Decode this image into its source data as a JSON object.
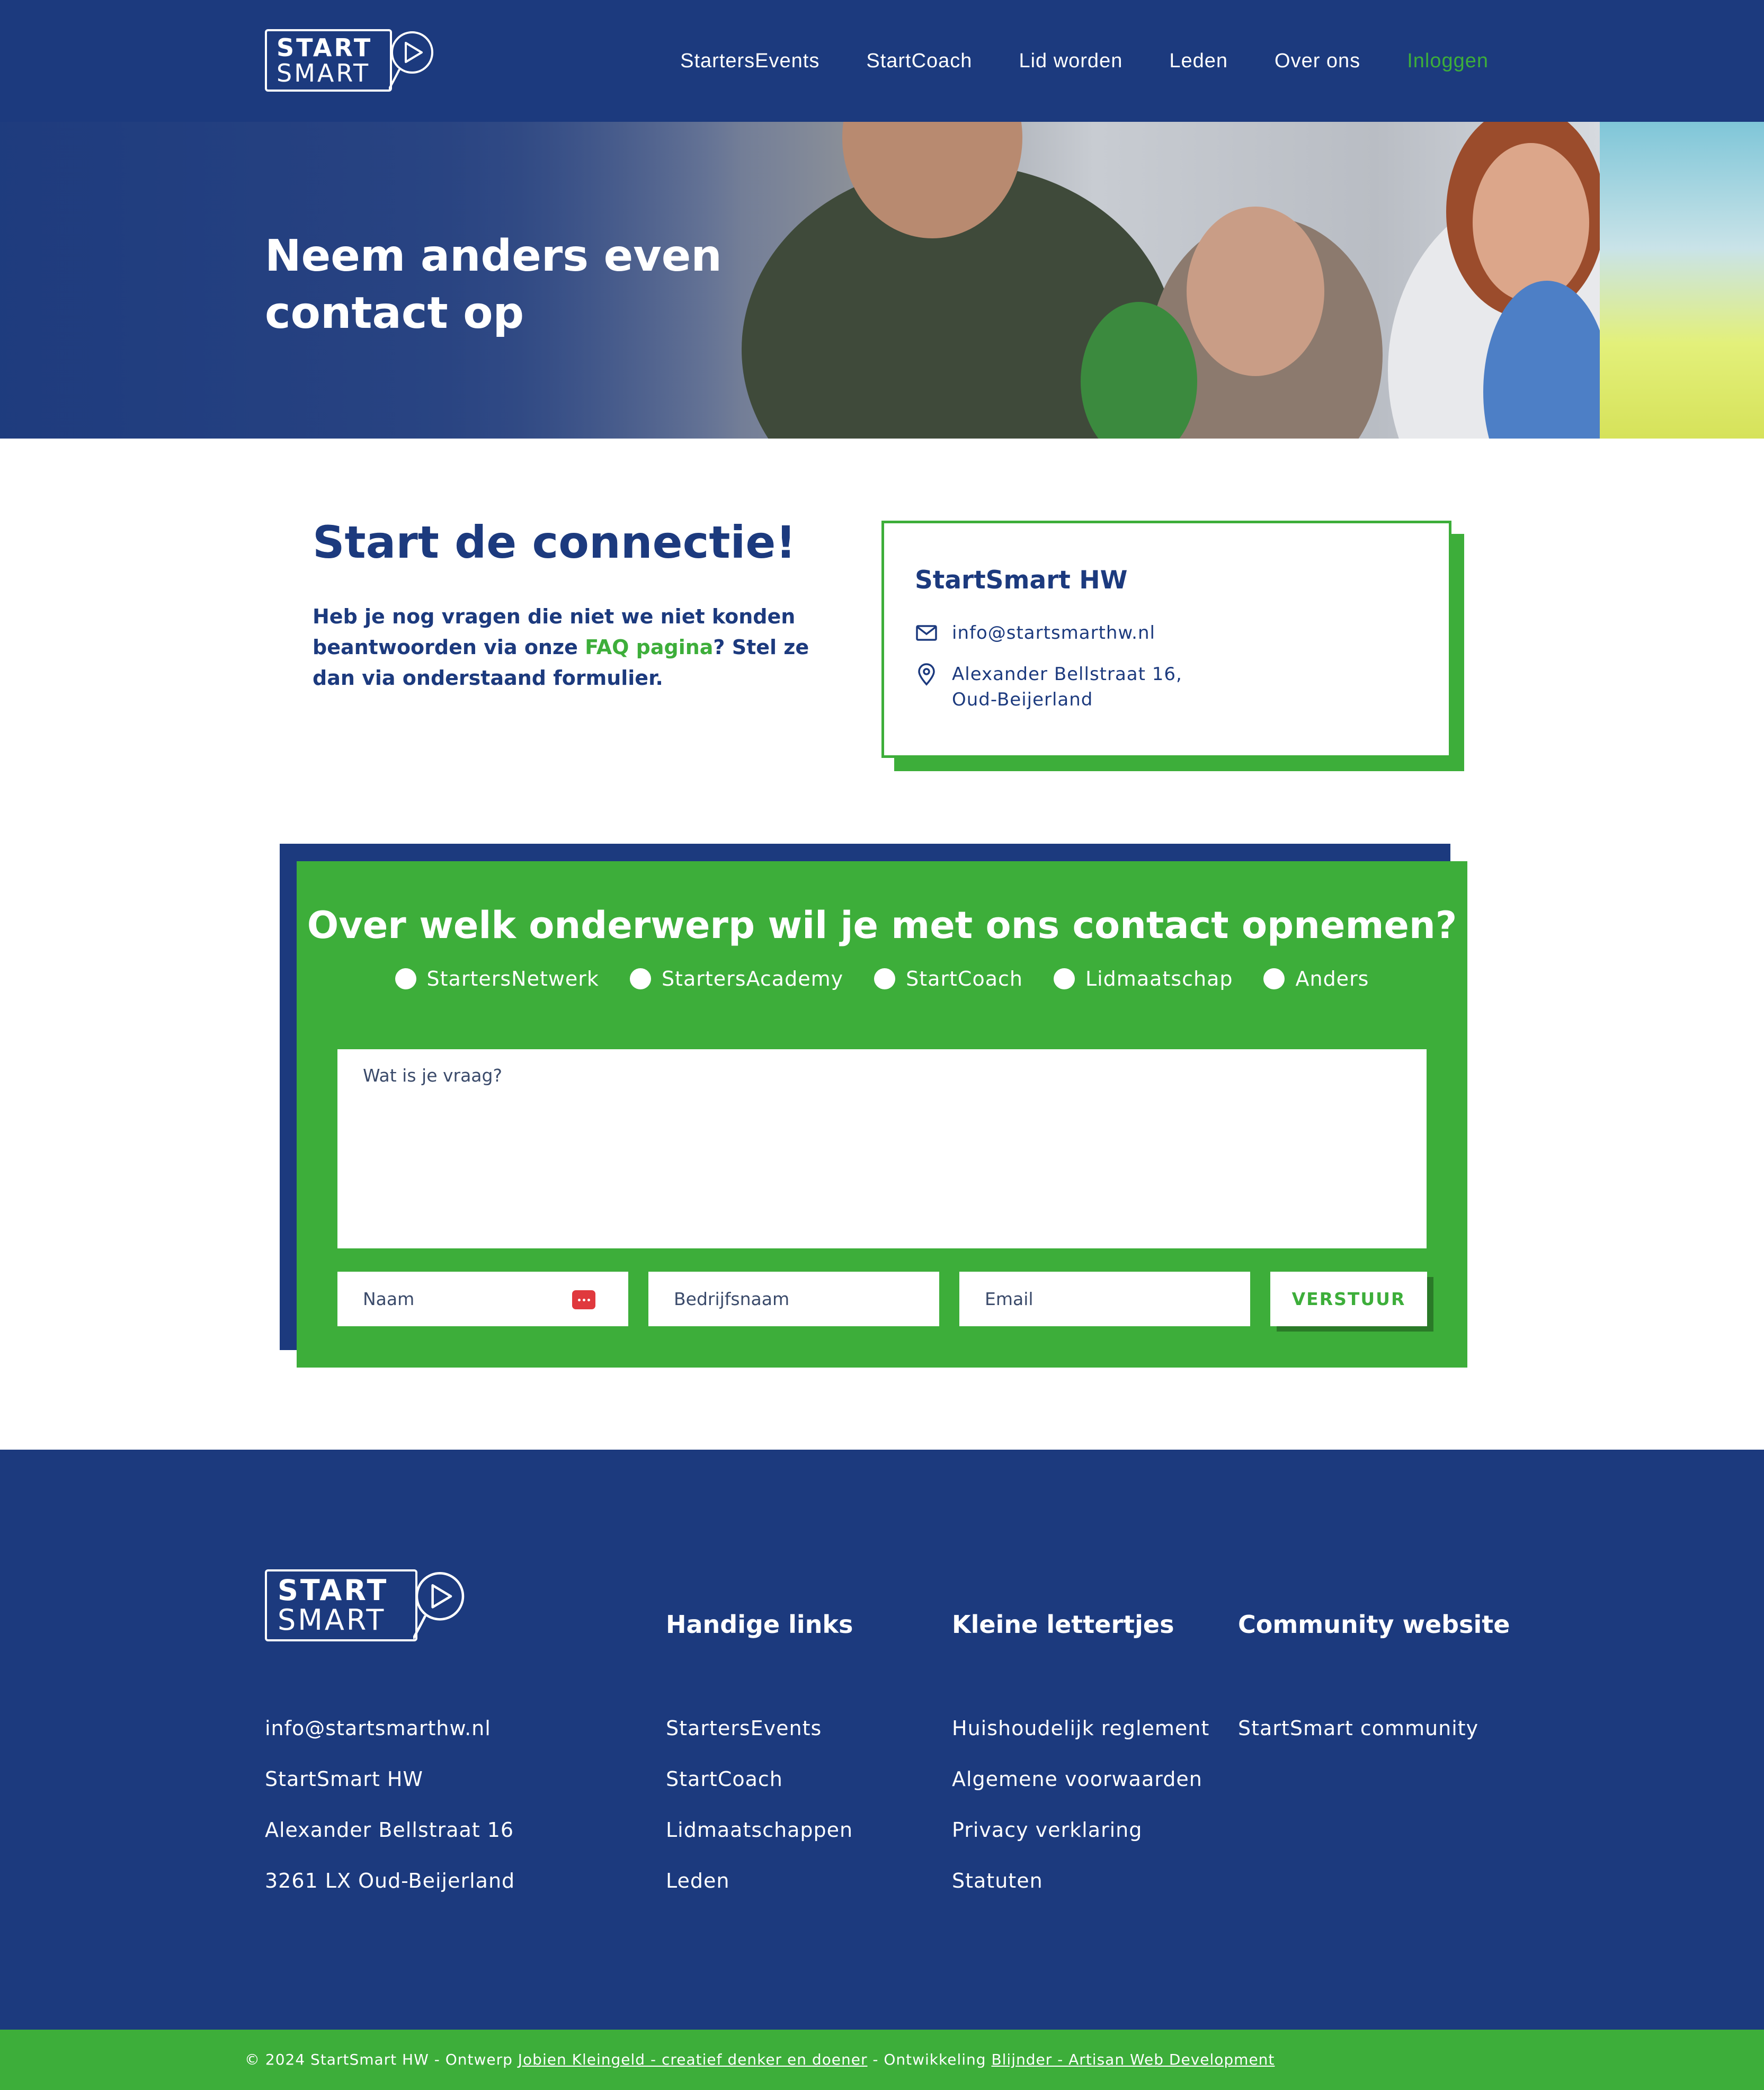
{
  "header": {
    "logo": {
      "line1": "START",
      "line2": "SMART"
    },
    "nav": [
      {
        "label": "StartersEvents"
      },
      {
        "label": "StartCoach"
      },
      {
        "label": "Lid worden"
      },
      {
        "label": "Leden"
      },
      {
        "label": "Over ons"
      },
      {
        "label": "Inloggen"
      }
    ]
  },
  "hero": {
    "title": "Neem anders even\ncontact op"
  },
  "intro": {
    "title": "Start de connectie!",
    "text_before": "Heb je nog vragen die niet we niet konden beantwoorden via onze ",
    "faq_link": "FAQ pagina",
    "text_after": "? Stel ze dan via onderstaand formulier."
  },
  "contact_card": {
    "title": "StartSmart HW",
    "email": "info@startsmarthw.nl",
    "address_line1": "Alexander Bellstraat 16,",
    "address_line2": "Oud-Beijerland"
  },
  "form": {
    "title": "Over welk onderwerp wil je met ons contact opnemen?",
    "topics": [
      {
        "label": "StartersNetwerk"
      },
      {
        "label": "StartersAcademy"
      },
      {
        "label": "StartCoach"
      },
      {
        "label": "Lidmaatschap"
      },
      {
        "label": "Anders"
      }
    ],
    "question_placeholder": "Wat is je vraag?",
    "name_placeholder": "Naam",
    "company_placeholder": "Bedrijfsnaam",
    "email_placeholder": "Email",
    "submit_label": "VERSTUUR"
  },
  "footer": {
    "logo": {
      "line1": "START",
      "line2": "SMART"
    },
    "contact": [
      "info@startsmarthw.nl",
      "StartSmart HW",
      "Alexander Bellstraat 16",
      "3261 LX Oud-Beijerland"
    ],
    "columns": [
      {
        "title": "Handige links",
        "links": [
          "StartersEvents",
          "StartCoach",
          "Lidmaatschappen",
          "Leden"
        ]
      },
      {
        "title": "Kleine lettertjes",
        "links": [
          "Huishoudelijk reglement",
          "Algemene voorwaarden",
          "Privacy verklaring",
          "Statuten"
        ]
      },
      {
        "title": "Community website",
        "links": [
          "StartSmart community"
        ]
      }
    ],
    "bottom": {
      "copyright": "© 2024 StartSmart HW - Ontwerp ",
      "design_link": "Jobien Kleingeld - creatief denker en doener",
      "dev_text": " - Ontwikkeling ",
      "dev_link": "Blijnder - Artisan Web Development"
    }
  },
  "colors": {
    "brand_blue": "#1c3a7e",
    "brand_green": "#3dae3a",
    "white": "#ffffff",
    "alert_red": "#e0393e"
  },
  "icons": [
    "logo-play-icon",
    "mail-icon",
    "location-pin-icon",
    "password-manager-icon"
  ]
}
